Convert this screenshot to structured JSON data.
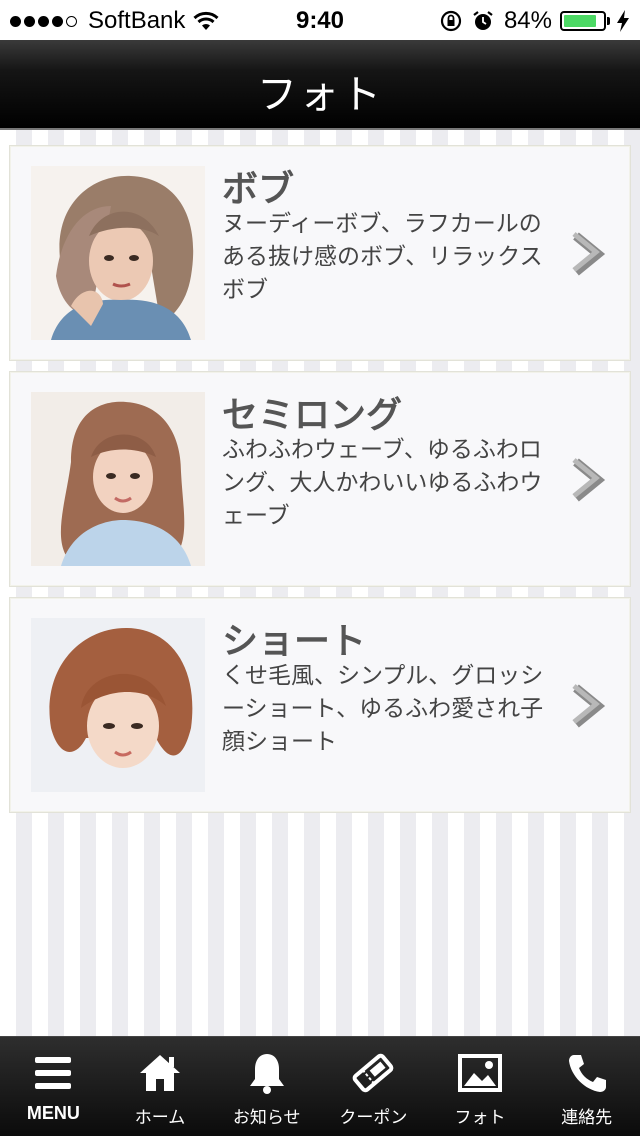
{
  "status_bar": {
    "carrier": "SoftBank",
    "time": "9:40",
    "battery_percent": "84%",
    "battery_level": 0.84,
    "signal_bars_filled": 4,
    "signal_bars_total": 5
  },
  "header": {
    "title": "フォト"
  },
  "categories": [
    {
      "title": "ボブ",
      "description": "ヌーディーボブ、ラフカールのある抜け感のボブ、リラックスボブ",
      "image": "hair-photo-bob"
    },
    {
      "title": "セミロング",
      "description": "ふわふわウェーブ、ゆるふわロング、大人かわいいゆるふわウェーブ",
      "image": "hair-photo-semi-long"
    },
    {
      "title": "ショート",
      "description": "くせ毛風、シンプル、グロッシーショート、ゆるふわ愛され子顔ショート",
      "image": "hair-photo-short"
    }
  ],
  "tab_bar": [
    {
      "label": "MENU",
      "icon": "menu-icon"
    },
    {
      "label": "ホーム",
      "icon": "home-icon"
    },
    {
      "label": "お知らせ",
      "icon": "bell-icon"
    },
    {
      "label": "クーポン",
      "icon": "coupon-ticket-icon"
    },
    {
      "label": "フォト",
      "icon": "photo-icon"
    },
    {
      "label": "連絡先",
      "icon": "phone-icon"
    }
  ],
  "colors": {
    "battery": "#4cd964",
    "header_bg": "#000000",
    "card_bg": "#f8f8fa",
    "text": "#555555"
  }
}
